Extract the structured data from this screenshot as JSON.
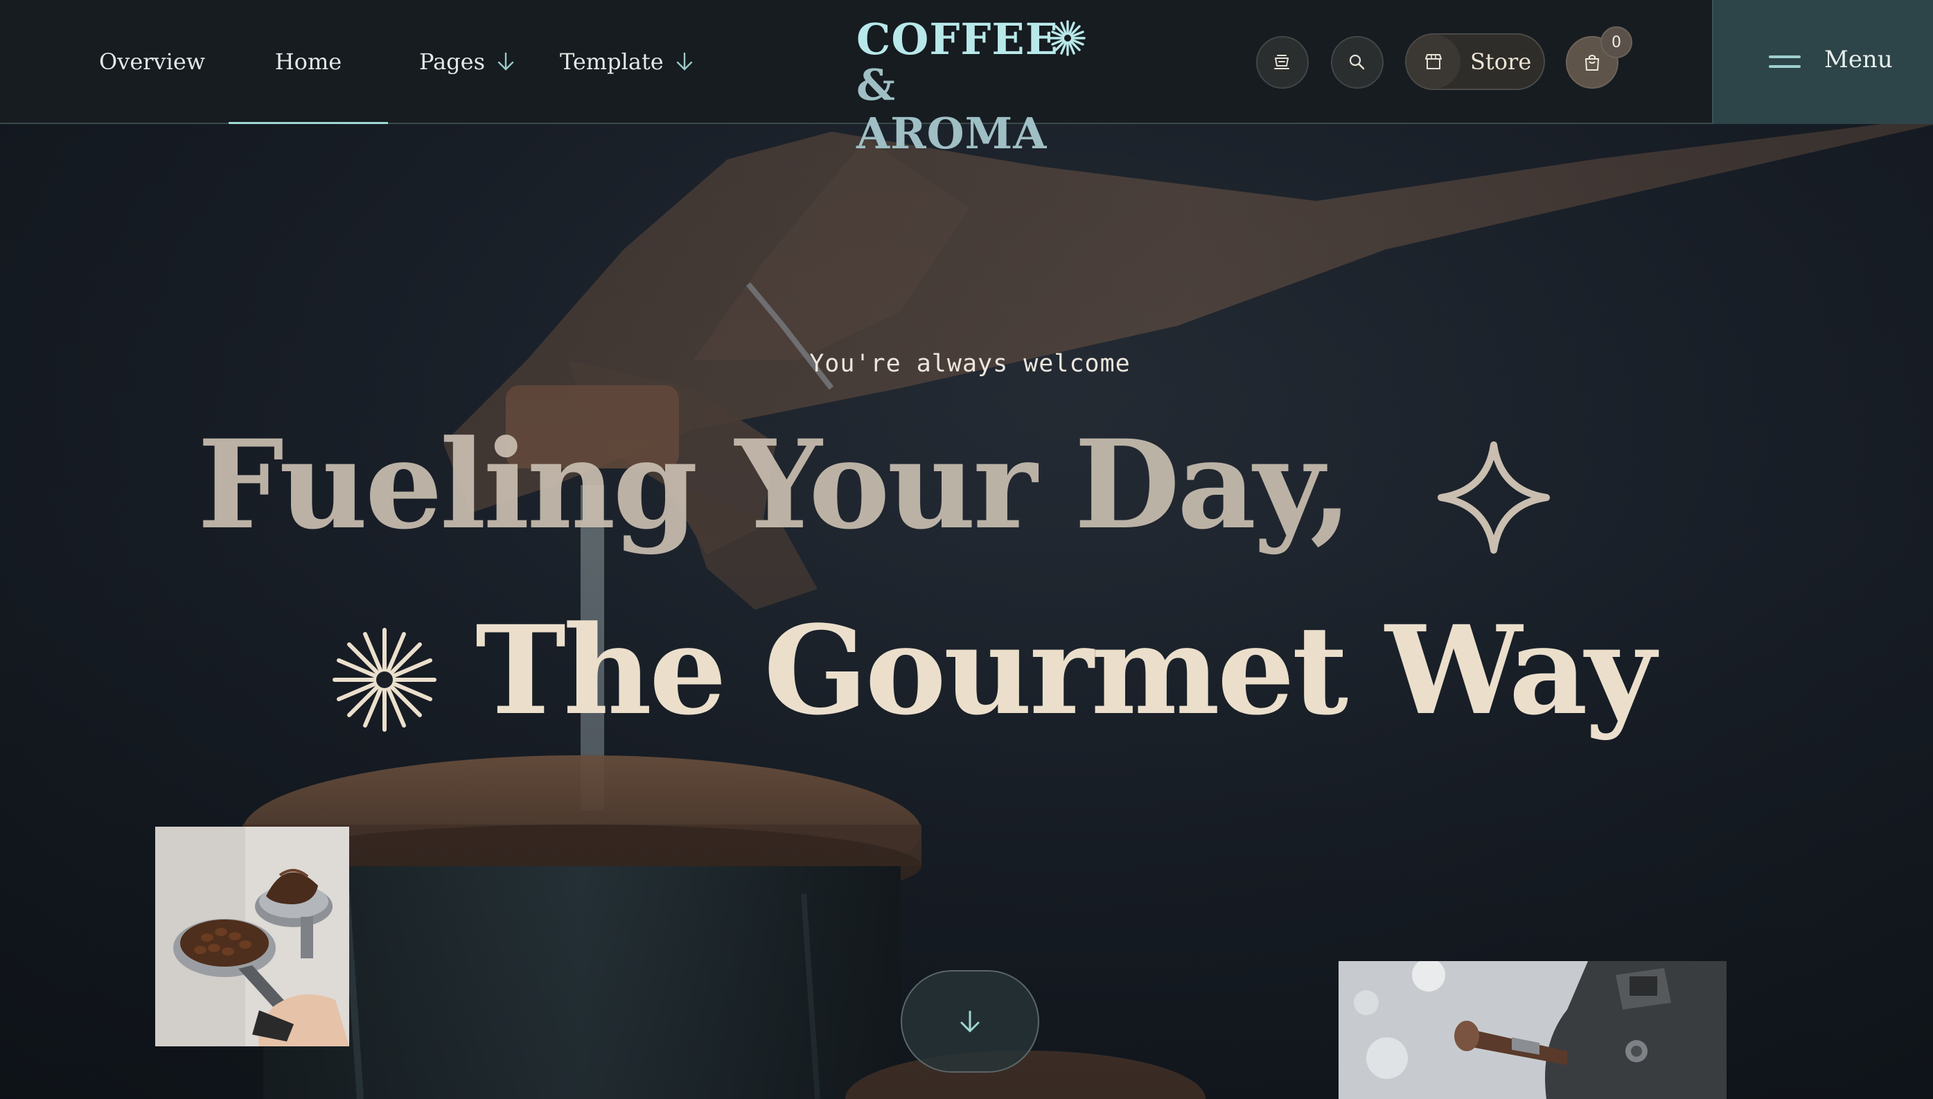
{
  "nav": {
    "items": [
      {
        "label": "Overview"
      },
      {
        "label": "Home"
      },
      {
        "label": "Pages"
      },
      {
        "label": "Template"
      }
    ]
  },
  "logo": {
    "line1": "COFFEE",
    "line2": "& AROMA"
  },
  "actions": {
    "store_label": "Store",
    "cart_count": "0"
  },
  "menu": {
    "label": "Menu"
  },
  "hero": {
    "tagline": "You're always welcome",
    "headline_line1": "Fueling Your Day,",
    "headline_line2": "The Gourmet Way"
  },
  "colors": {
    "accent_teal": "#9ed9d4",
    "logo_teal": "#b8e8ea",
    "cream_text": "#ebdfcc",
    "menu_panel": "#2d4448",
    "header_bg": "#161c20"
  },
  "icons": {
    "coffee_cup": "coffee-cup-icon",
    "search": "search-icon",
    "store": "store-icon",
    "cart": "shopping-bag-icon",
    "menu": "hamburger-icon",
    "scroll": "arrow-down-icon"
  }
}
